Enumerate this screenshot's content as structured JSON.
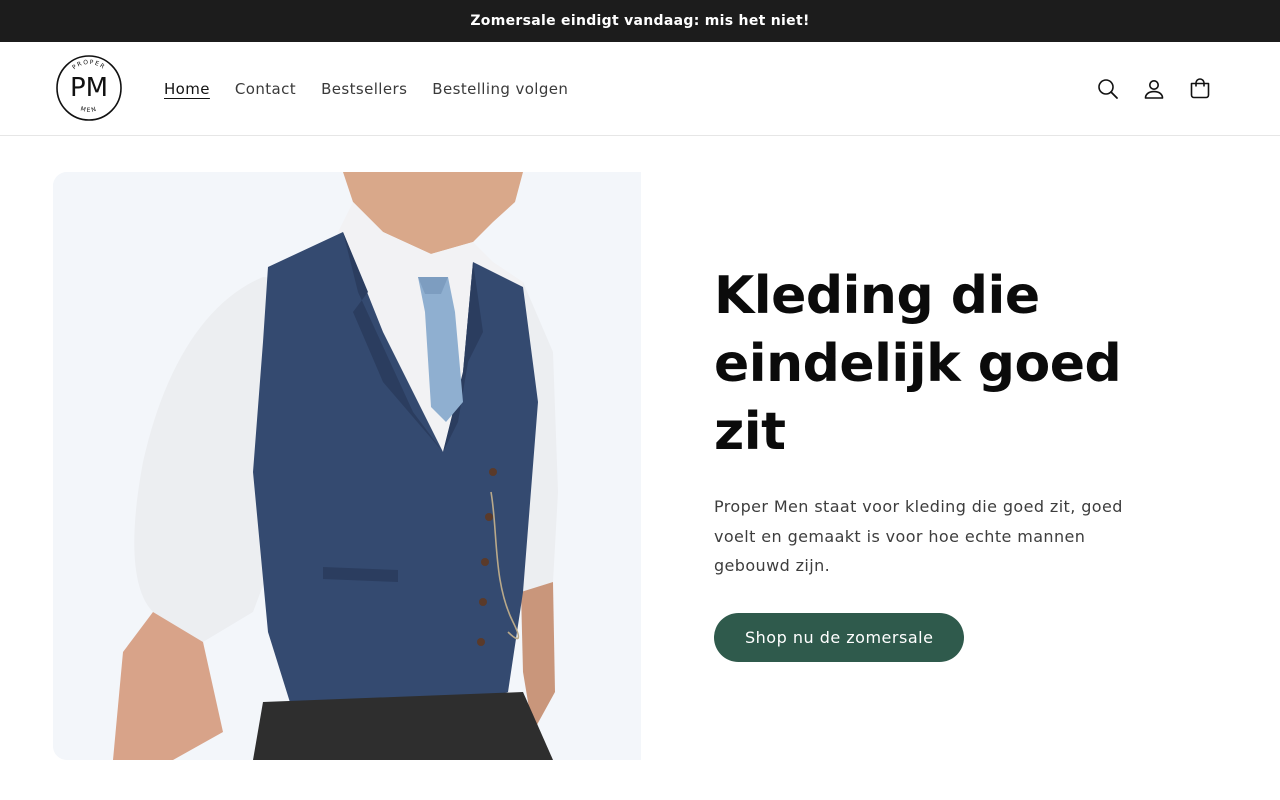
{
  "announcement": {
    "text": "Zomersale eindigt vandaag: mis het niet!"
  },
  "header": {
    "logo": {
      "monogram": "PM",
      "top_text": "PROPER",
      "bottom_text": "MEN"
    },
    "nav": [
      {
        "label": "Home",
        "active": true
      },
      {
        "label": "Contact"
      },
      {
        "label": "Bestsellers"
      },
      {
        "label": "Bestelling volgen"
      }
    ],
    "icons": [
      "search-icon",
      "account-icon",
      "cart-icon"
    ]
  },
  "hero": {
    "image": "man-in-navy-tweed-vest-photo",
    "title": "Kleding die eindelijk goed zit",
    "description": "Proper Men staat voor kleding die goed zit, goed voelt en gemaakt is voor hoe echte mannen gebouwd zijn.",
    "cta_label": "Shop nu de zomersale"
  },
  "colors": {
    "announcement_bg": "#1c1c1c",
    "cta_bg": "#2f5a4c",
    "image_bg": "#f3f6fa"
  }
}
